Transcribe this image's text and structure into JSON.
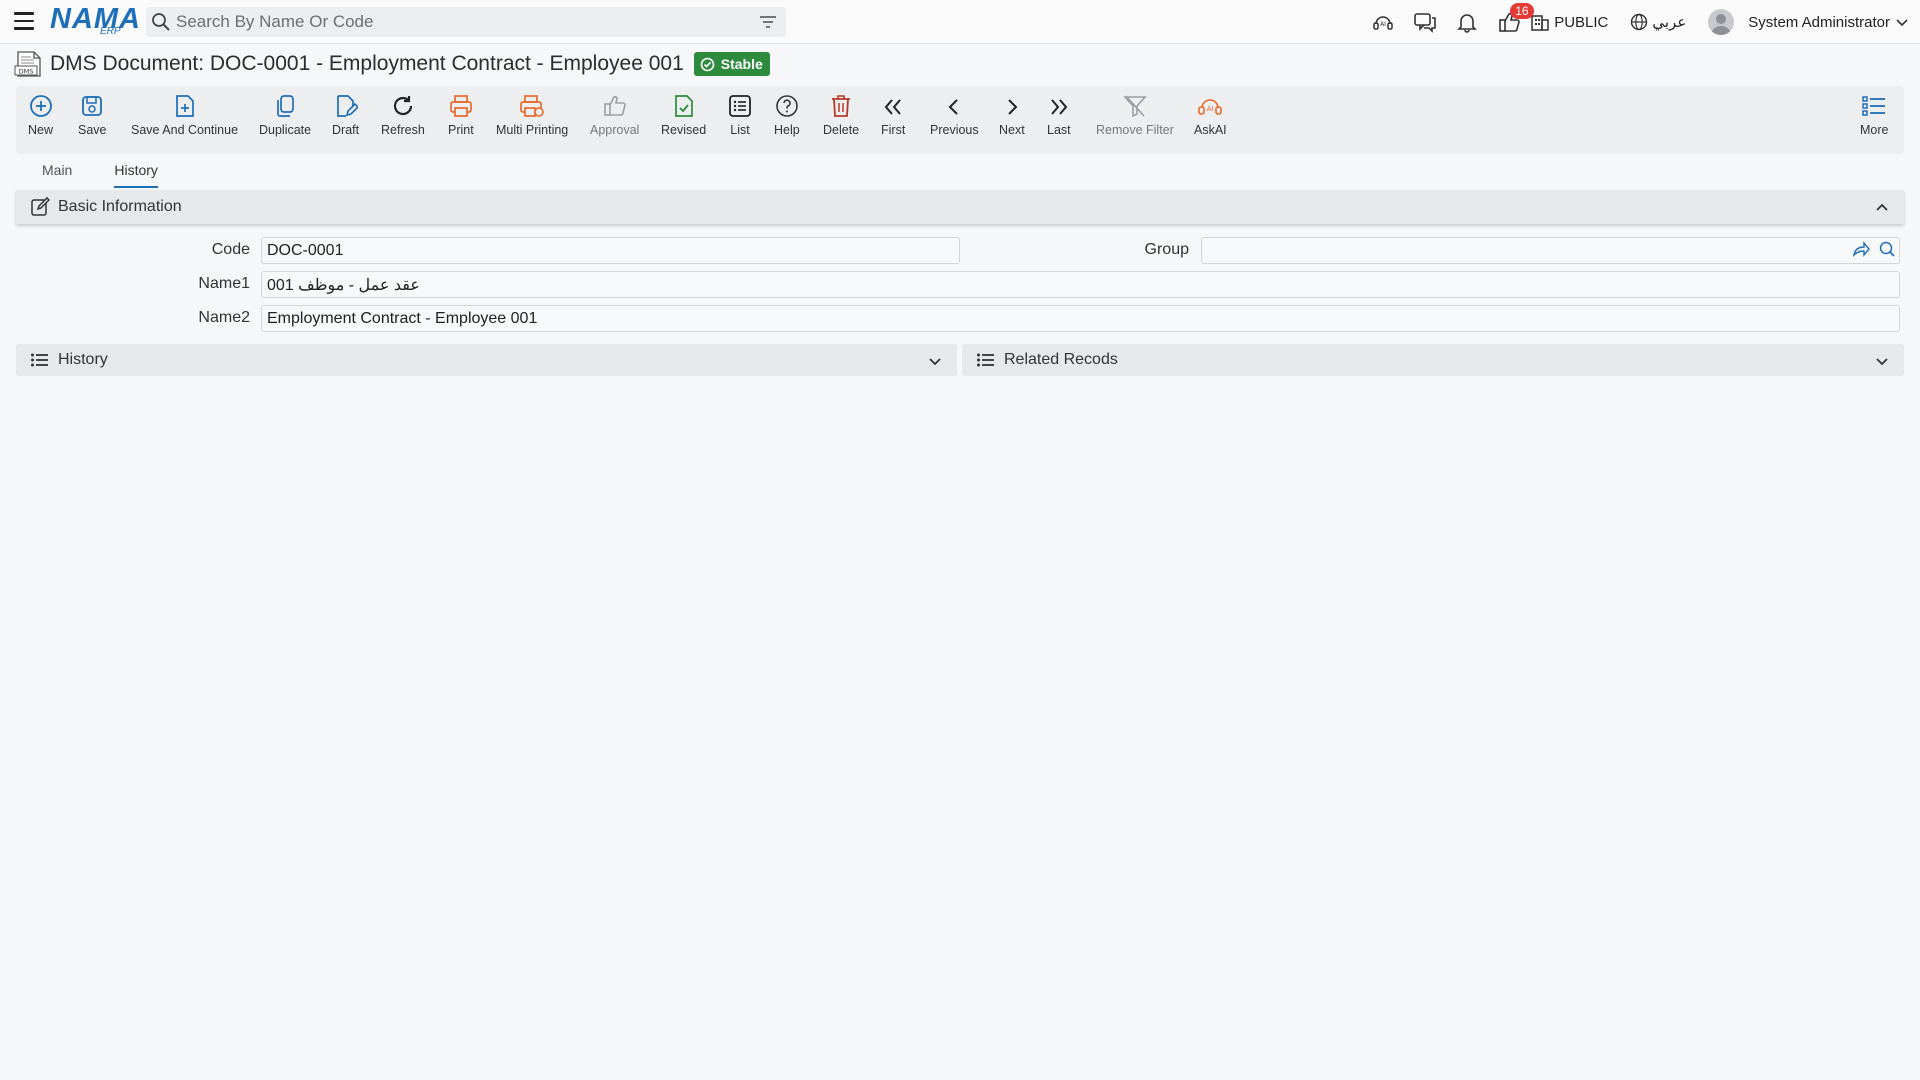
{
  "app": {
    "logo_text": "NAMA",
    "logo_sub": "ERP",
    "search_placeholder": "Search By Name Or Code"
  },
  "topbar": {
    "notifications_count": "16",
    "branch": "PUBLIC",
    "language": "عربي",
    "user_name": "System Administrator"
  },
  "page": {
    "title": "DMS Document: DOC-0001 - Employment Contract - Employee 001",
    "status": "Stable",
    "doc_icon_label": "DMS"
  },
  "toolbar": [
    {
      "label": "New",
      "icon": "plus-circle-icon",
      "color": "#1e6fb8"
    },
    {
      "label": "Save",
      "icon": "save-icon",
      "color": "#1e6fb8"
    },
    {
      "label": "Save And Continue",
      "icon": "save-continue-icon",
      "color": "#1e6fb8"
    },
    {
      "label": "Duplicate",
      "icon": "duplicate-icon",
      "color": "#1e6fb8"
    },
    {
      "label": "Draft",
      "icon": "draft-icon",
      "color": "#1e6fb8"
    },
    {
      "label": "Refresh",
      "icon": "refresh-icon",
      "color": "#222222"
    },
    {
      "label": "Print",
      "icon": "print-icon",
      "color": "#e8692c"
    },
    {
      "label": "Multi Printing",
      "icon": "multi-print-icon",
      "color": "#e8692c"
    },
    {
      "label": "Approval",
      "icon": "thumbs-up-icon",
      "color": "#9aa0a6"
    },
    {
      "label": "Revised",
      "icon": "revised-icon",
      "color": "#2e8b3e"
    },
    {
      "label": "List",
      "icon": "list-icon",
      "color": "#222222"
    },
    {
      "label": "Help",
      "icon": "help-icon",
      "color": "#333333"
    },
    {
      "label": "Delete",
      "icon": "trash-icon",
      "color": "#b33a2a"
    },
    {
      "label": "First",
      "icon": "double-chevron-left-icon",
      "color": "#222222"
    },
    {
      "label": "Previous",
      "icon": "chevron-left-icon",
      "color": "#222222"
    },
    {
      "label": "Next",
      "icon": "chevron-right-icon",
      "color": "#222222"
    },
    {
      "label": "Last",
      "icon": "double-chevron-right-icon",
      "color": "#222222"
    },
    {
      "label": "Remove Filter",
      "icon": "remove-filter-icon",
      "color": "#9aa0a6"
    },
    {
      "label": "AskAI",
      "icon": "ai-icon",
      "color": "#e8692c"
    },
    {
      "label": "More",
      "icon": "more-list-icon",
      "color": "#1e6fb8"
    }
  ],
  "tabs": [
    {
      "label": "Main",
      "active": false
    },
    {
      "label": "History",
      "active": true
    }
  ],
  "basic_info": {
    "title": "Basic Information",
    "code_label": "Code",
    "code_value": "DOC-0001",
    "group_label": "Group",
    "group_value": "",
    "name1_label": "Name1",
    "name1_value": "عقد عمل - موظف 001",
    "name2_label": "Name2",
    "name2_value": "Employment Contract - Employee 001"
  },
  "sections": {
    "history": "History",
    "related": "Related Recods"
  },
  "colors": {
    "accent": "#1e6fb8",
    "status_stable": "#2e8b3e",
    "badge": "#e53935"
  }
}
